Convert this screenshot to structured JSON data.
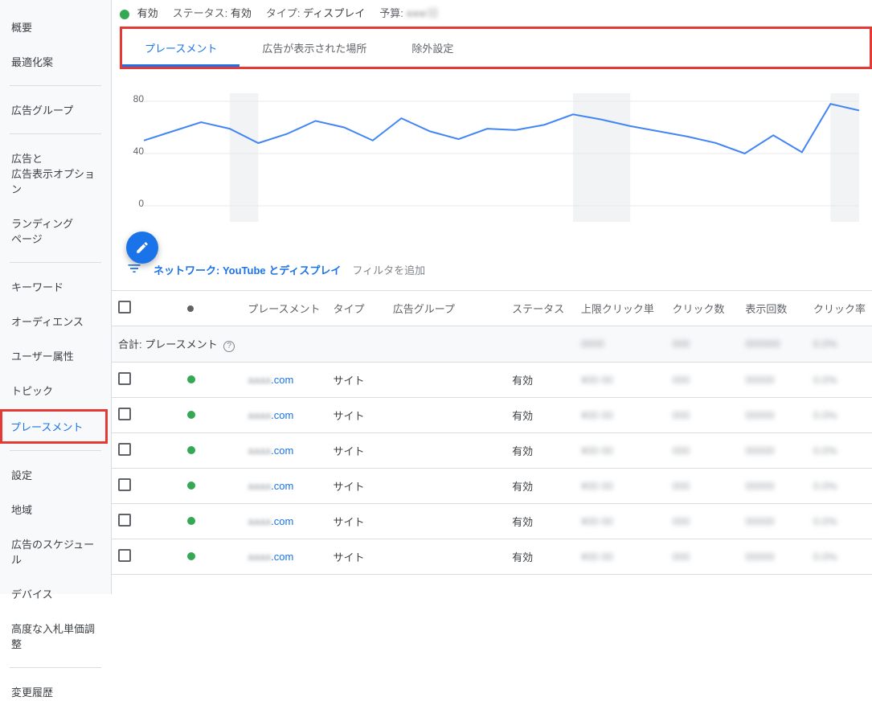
{
  "sidebar": {
    "items": [
      {
        "label": "概要",
        "key": "overview"
      },
      {
        "label": "最適化案",
        "key": "recommendations"
      },
      {
        "divider": true
      },
      {
        "label": "広告グループ",
        "key": "adgroups"
      },
      {
        "divider": true
      },
      {
        "label": "広告と\n広告表示オプション",
        "key": "ads-extensions"
      },
      {
        "label": "ランディング\nページ",
        "key": "landing"
      },
      {
        "divider": true
      },
      {
        "label": "キーワード",
        "key": "keywords"
      },
      {
        "label": "オーディエンス",
        "key": "audiences"
      },
      {
        "label": "ユーザー属性",
        "key": "demographics"
      },
      {
        "label": "トピック",
        "key": "topics"
      },
      {
        "label": "プレースメント",
        "key": "placements",
        "selected": true
      },
      {
        "divider": true
      },
      {
        "label": "設定",
        "key": "settings"
      },
      {
        "label": "地域",
        "key": "locations"
      },
      {
        "label": "広告のスケジュール",
        "key": "schedule"
      },
      {
        "label": "デバイス",
        "key": "devices"
      },
      {
        "label": "高度な入札単価調整",
        "key": "bid-adj"
      },
      {
        "divider": true
      },
      {
        "label": "変更履歴",
        "key": "history"
      }
    ]
  },
  "header": {
    "enabled_label": "有効",
    "status_label": "ステータス:",
    "status_value": "有効",
    "type_label": "タイプ:",
    "type_value": "ディスプレイ",
    "budget_label": "予算:",
    "budget_value": "●●●/日"
  },
  "tabs": [
    {
      "label": "プレースメント",
      "active": true
    },
    {
      "label": "広告が表示された場所",
      "active": false
    },
    {
      "label": "除外設定",
      "active": false
    }
  ],
  "chart_data": {
    "type": "line",
    "x_count": 26,
    "values": [
      50,
      57,
      64,
      59,
      48,
      55,
      65,
      60,
      50,
      67,
      57,
      51,
      59,
      58,
      62,
      70,
      66,
      61,
      57,
      53,
      48,
      40,
      54,
      41,
      78,
      73
    ],
    "highlight_bands": [
      [
        3,
        4
      ],
      [
        15,
        17
      ],
      [
        24,
        26
      ]
    ],
    "ylabel": "",
    "xlabel": "",
    "ylim": [
      0,
      80
    ],
    "yticks": [
      0,
      40,
      80
    ]
  },
  "filter": {
    "network_label": "ネットワーク:",
    "network_value": "YouTube とディスプレイ",
    "add_filter": "フィルタを追加"
  },
  "table": {
    "columns": [
      "",
      "",
      "プレースメント",
      "タイプ",
      "広告グループ",
      "ステータス",
      "上限クリック単",
      "クリック数",
      "表示回数",
      "クリック率"
    ],
    "summary_label": "合計: プレースメント",
    "type_value": "サイト",
    "status_value": "有効",
    "rows": [
      {
        "placement": "●●●●.com"
      },
      {
        "placement": "●●●●.com"
      },
      {
        "placement": "●●●●.com"
      },
      {
        "placement": "●●●●.com"
      },
      {
        "placement": "●●●●.com"
      },
      {
        "placement": "●●●●.com"
      }
    ]
  }
}
